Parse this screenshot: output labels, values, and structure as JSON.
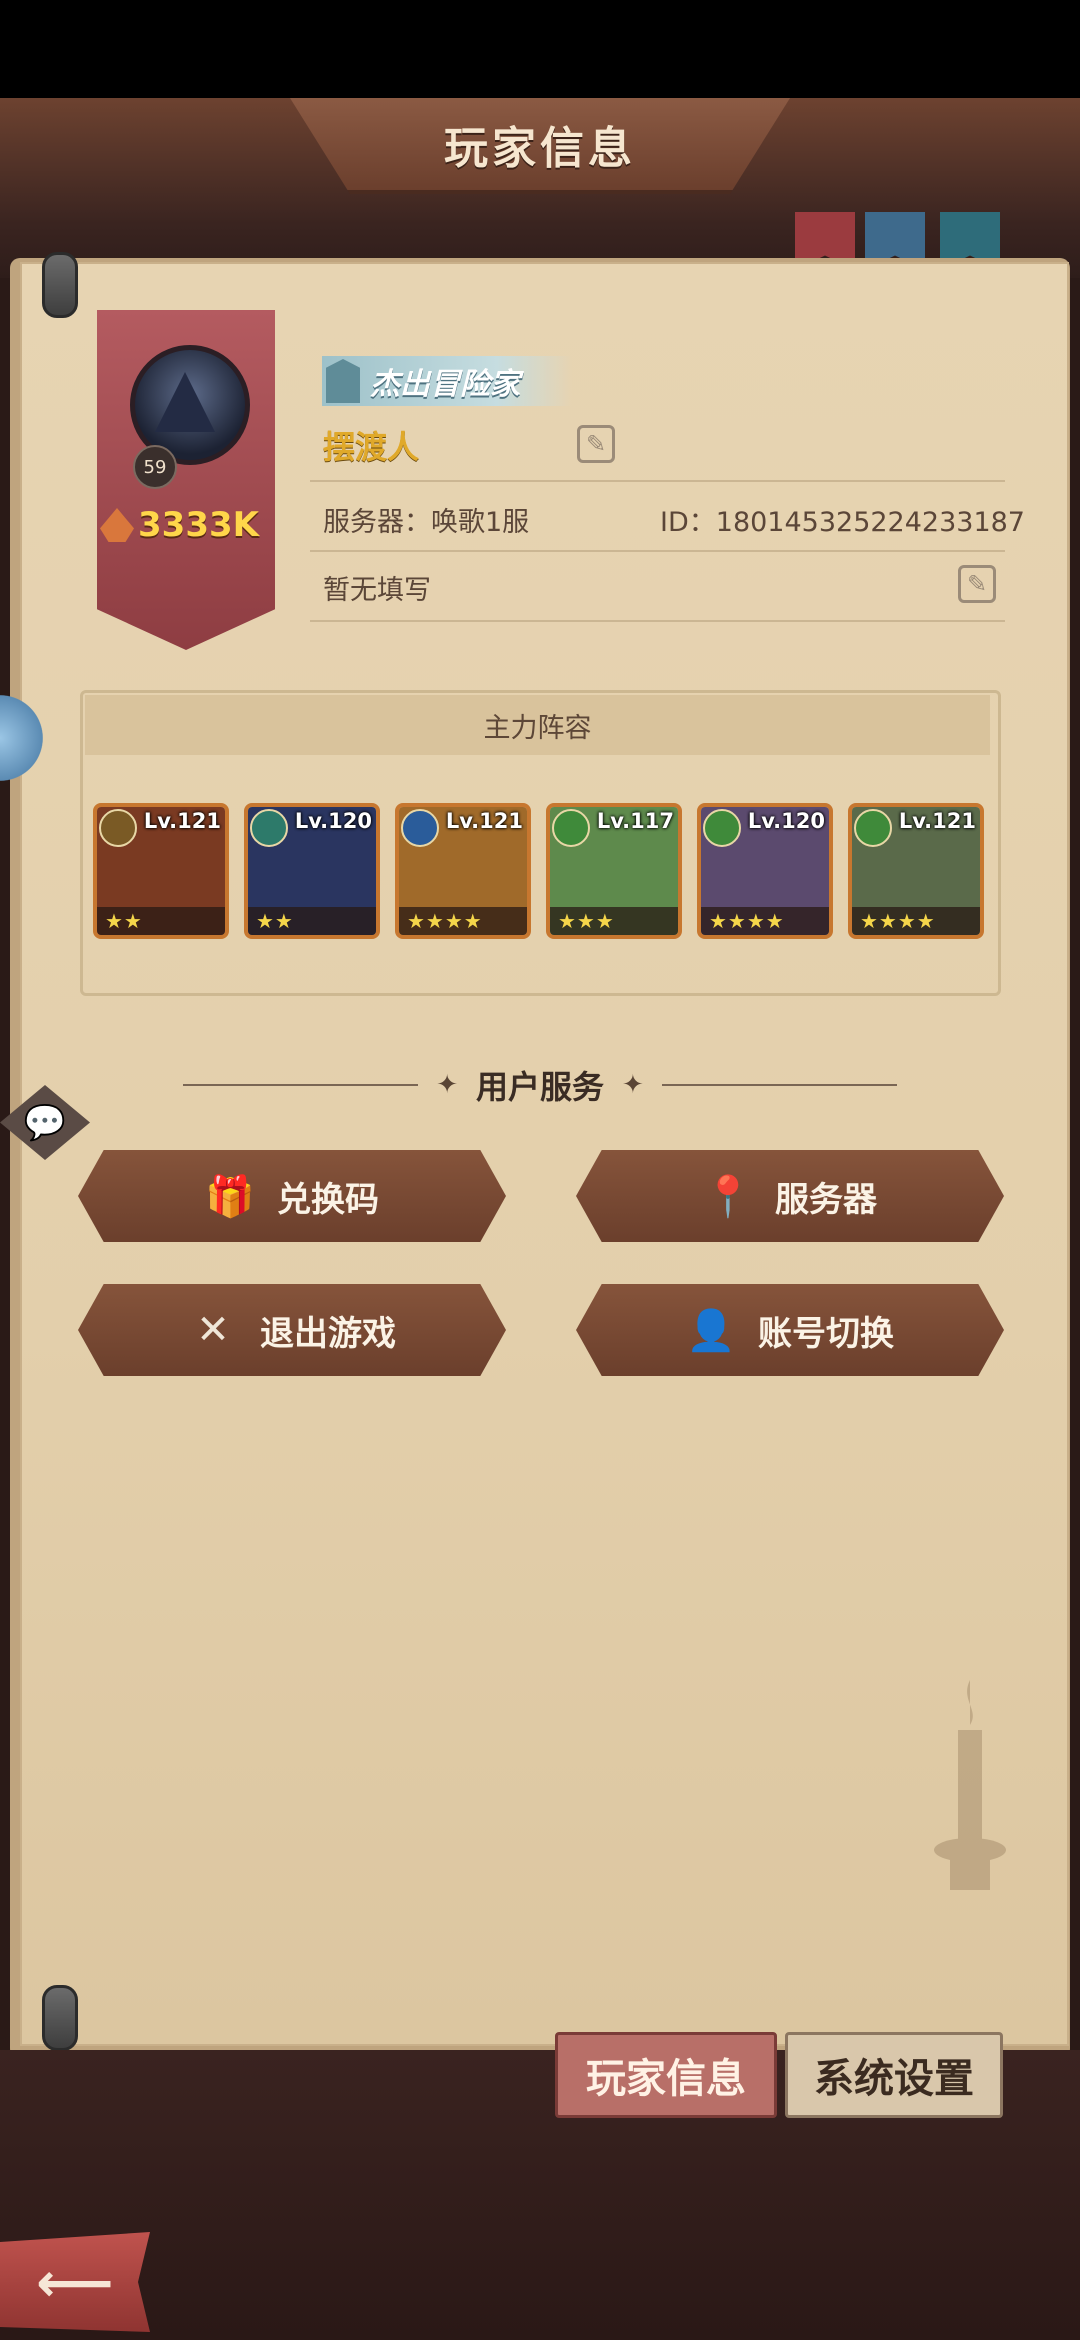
{
  "window": {
    "title": "玩家信息"
  },
  "profile": {
    "rank_title": "杰出冒险家",
    "name": "摆渡人",
    "level": "59",
    "power": "3333K",
    "server_label": "服务器：",
    "server_value": "唤歌1服",
    "id_label": "ID：",
    "id_value": "180145325224233187",
    "signature": "暂无填写"
  },
  "lineup": {
    "title": "主力阵容",
    "heroes": [
      {
        "level": "Lv.121",
        "stars": "★★",
        "element_color": "#7a5a25",
        "bg": "#7a3a22"
      },
      {
        "level": "Lv.120",
        "stars": "★★",
        "element_color": "#2d7a6a",
        "bg": "#2a3560"
      },
      {
        "level": "Lv.121",
        "stars": "★★★★",
        "element_color": "#2a5c9a",
        "bg": "#a06a2a"
      },
      {
        "level": "Lv.117",
        "stars": "★★★",
        "element_color": "#3f8a3a",
        "bg": "#5e8a4c"
      },
      {
        "level": "Lv.120",
        "stars": "★★★★",
        "element_color": "#3f8a3a",
        "bg": "#5b4a6e"
      },
      {
        "level": "Lv.121",
        "stars": "★★★★",
        "element_color": "#3f8a3a",
        "bg": "#5a6a4a"
      }
    ]
  },
  "services": {
    "title": "用户服务",
    "buttons": {
      "redeem": {
        "label": "兑换码",
        "icon": "gift-icon"
      },
      "server": {
        "label": "服务器",
        "icon": "location-icon"
      },
      "exit": {
        "label": "退出游戏",
        "icon": "close-icon"
      },
      "switch": {
        "label": "账号切换",
        "icon": "user-icon"
      }
    }
  },
  "tabs": {
    "player_info": "玩家信息",
    "system_settings": "系统设置"
  },
  "colors": {
    "accent": "#ffd64a",
    "button": "#7a4a34",
    "parchment": "#e7d4b2"
  }
}
